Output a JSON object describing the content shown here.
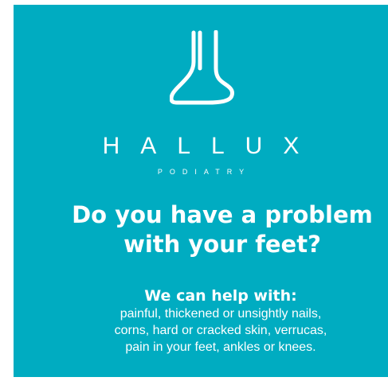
{
  "colors": {
    "background": "#00acc1",
    "text": "#ffffff"
  },
  "logo": {
    "icon": "foot-icon",
    "brand_name": "HALLUX",
    "brand_sub": "PODIATRY"
  },
  "headline": {
    "line1": "Do you have a problem",
    "line2": "with your feet?"
  },
  "help": {
    "title": "We can help with:",
    "lines": [
      "painful, thickened or unsightly nails,",
      "corns, hard or cracked skin, verrucas,",
      "pain in your feet, ankles or knees."
    ]
  }
}
